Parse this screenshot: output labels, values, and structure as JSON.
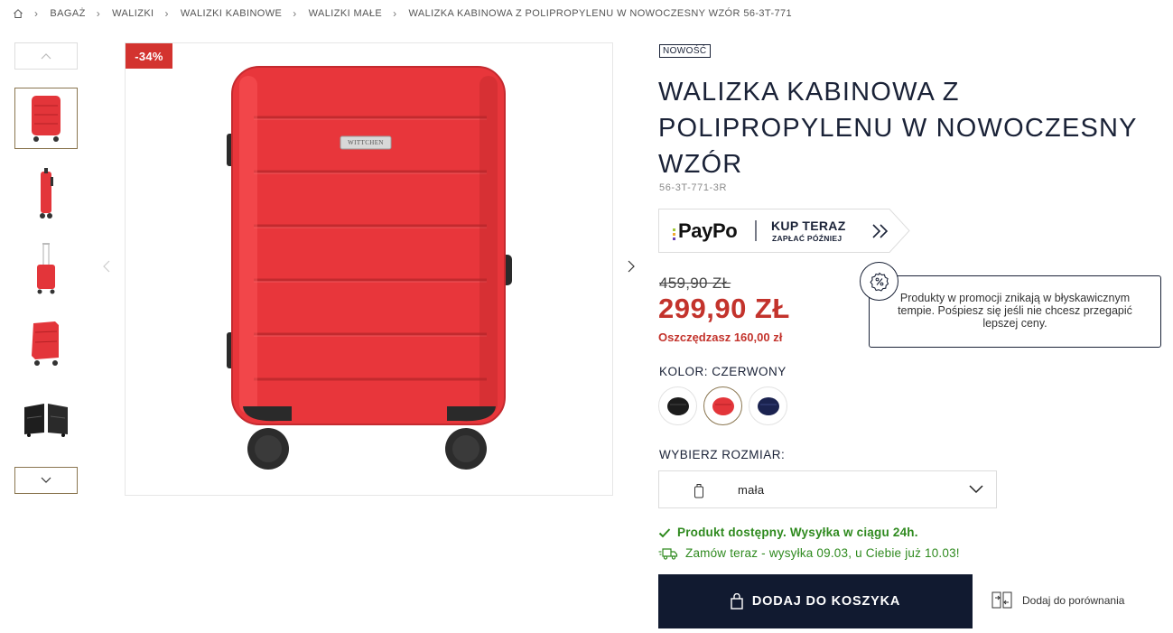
{
  "breadcrumb": {
    "home_icon": "home-icon",
    "items": [
      "BAGAŻ",
      "WALIZKI",
      "WALIZKI KABINOWE",
      "WALIZKI MAŁE",
      "WALIZKA KABINOWA Z POLIPROPYLENU W NOWOCZESNY WZÓR 56-3T-771"
    ]
  },
  "gallery": {
    "discount_badge": "-34%",
    "thumbnail_count": 5,
    "active_thumbnail": 1
  },
  "product": {
    "badge": "NOWOŚĆ",
    "title": "WALIZKA KABINOWA Z POLIPROPYLENU W NOWOCZESNY WZÓR",
    "sku": "56-3T-771-3R",
    "brand_plate": "WITTCHEN"
  },
  "paypo": {
    "logo": "PayPo",
    "line1": "KUP TERAZ",
    "line2": "ZAPŁAĆ PÓŹNIEJ"
  },
  "pricing": {
    "old_price": "459,90 ZŁ",
    "new_price": "299,90 ZŁ",
    "savings": "Oszczędzasz 160,00 zł"
  },
  "promo": {
    "text": "Produkty w promocji znikają w błyskawicznym tempie. Pośpiesz się jeśli nie chcesz przegapić lepszej ceny."
  },
  "color": {
    "label": "KOLOR: CZERWONY",
    "swatches": [
      {
        "name": "czarny",
        "hex": "#1c1c1c",
        "selected": false
      },
      {
        "name": "czerwony",
        "hex": "#e3353a",
        "selected": true
      },
      {
        "name": "granatowy",
        "hex": "#1b2350",
        "selected": false
      }
    ]
  },
  "size": {
    "label": "WYBIERZ ROZMIAR:",
    "selected": "mała"
  },
  "stock": {
    "availability": "Produkt dostępny. Wysyłka w ciągu 24h.",
    "shipping": "Zamów teraz - wysyłka 09.03, u Ciebie już 10.03!"
  },
  "actions": {
    "add_to_cart": "DODAJ DO KOSZYKA",
    "compare": "Dodaj do porównania"
  },
  "colors": {
    "navy": "#111a30",
    "sale_red": "#c3332c",
    "stock_green": "#2f8a1f",
    "gold_border": "#8a7650"
  }
}
